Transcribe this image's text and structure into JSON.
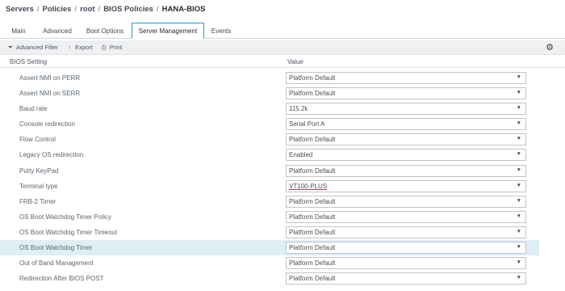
{
  "breadcrumb": {
    "items": [
      "Servers",
      "Policies",
      "root",
      "BIOS Policies"
    ],
    "separator": "/",
    "current": "HANA-BIOS"
  },
  "tabs": [
    {
      "label": "Main",
      "active": false
    },
    {
      "label": "Advanced",
      "active": false
    },
    {
      "label": "Boot Options",
      "active": false
    },
    {
      "label": "Server Management",
      "active": true
    },
    {
      "label": "Events",
      "active": false
    }
  ],
  "toolbar": {
    "filter_icon": "filter-icon",
    "filter_label": "Advanced Filter",
    "export_icon": "export-icon",
    "export_label": "Export",
    "print_icon": "print-icon",
    "print_label": "Print",
    "settings_icon": "gear-icon"
  },
  "table": {
    "columns": [
      "BIOS Setting",
      "Value"
    ],
    "rows": [
      {
        "setting": "Assert NMI on PERR",
        "value": "Platform Default"
      },
      {
        "setting": "Assert NMI on SERR",
        "value": "Platform Default"
      },
      {
        "setting": "Baud rate",
        "value": "115.2k"
      },
      {
        "setting": "Console redirection",
        "value": "Serial Port A"
      },
      {
        "setting": "Flow Control",
        "value": "Platform Default"
      },
      {
        "setting": "Legacy OS redirection",
        "value": "Enabled"
      },
      {
        "setting": "Putty KeyPad",
        "value": "Platform Default"
      },
      {
        "setting": "Terminal type",
        "value": "VT100-PLUS"
      },
      {
        "setting": "FRB-2 Timer",
        "value": "Platform Default"
      },
      {
        "setting": "OS Boot Watchdog Timer Policy",
        "value": "Platform Default"
      },
      {
        "setting": "OS Boot Watchdog Timer Timeout",
        "value": "Platform Default"
      },
      {
        "setting": "OS Boot Watchdog Timer",
        "value": "Platform Default",
        "highlighted": true
      },
      {
        "setting": "Out of Band Management",
        "value": "Platform Default"
      },
      {
        "setting": "Redirection After BIOS POST",
        "value": "Platform Default"
      }
    ]
  },
  "colors": {
    "active_tab_border": "#2b9ac7",
    "toolbar_bg": "#eef0f2",
    "row_highlight": "#ddeef5"
  }
}
